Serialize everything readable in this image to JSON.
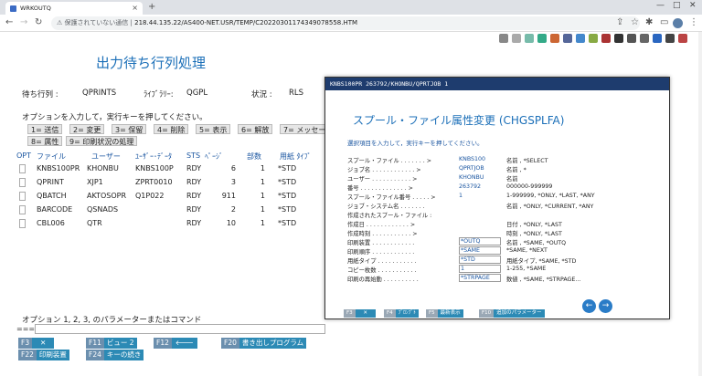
{
  "browser": {
    "tab_title": "WRKOUTQ",
    "tab_close": "×",
    "new_tab": "+",
    "security_warning": "保護されていない通信",
    "url": "218.44.135.22/AS400-NET.USR/TEMP/C20220301174349078558.HTM"
  },
  "page": {
    "title": "出力待ち行列処理",
    "outq_label": "待ち行列 :",
    "outq_value": "QPRINTS",
    "library_label": "ﾗｲﾌﾞﾗﾘｰ:",
    "library_value": "QGPL",
    "status_label": "状況 :",
    "status_value": "RLS",
    "instruction": "オプションを入力して，実行キーを押してください。",
    "options": [
      "1= 送信",
      "2= 変更",
      "3= 保留",
      "4= 削除",
      "5= 表示",
      "6= 解放",
      "7= メッセー",
      "8= 属性",
      "9= 印刷状況の処理"
    ],
    "columns": [
      "OPT",
      "ファイル",
      "ユーザー",
      "ﾕｰｻﾞｰ･ﾃﾞｰﾀ",
      "STS",
      "ﾍﾟｰｼﾞ",
      "部数",
      "用紙 ﾀｲﾌﾟ"
    ],
    "rows": [
      {
        "file": "KNBS100PR",
        "user": "KHONBU",
        "udata": "KNBS100P",
        "sts": "RDY",
        "pages": "6",
        "copies": "1",
        "form": "*STD"
      },
      {
        "file": "QPRINT",
        "user": "XJP1",
        "udata": "ZPRT0010",
        "sts": "RDY",
        "pages": "3",
        "copies": "1",
        "form": "*STD"
      },
      {
        "file": "QBATCH",
        "user": "AKTOSOPR",
        "udata": "Q1P022",
        "sts": "RDY",
        "pages": "911",
        "copies": "1",
        "form": "*STD"
      },
      {
        "file": "BARCODE",
        "user": "QSNADS",
        "udata": "",
        "sts": "RDY",
        "pages": "2",
        "copies": "1",
        "form": "*STD"
      },
      {
        "file": "CBL006",
        "user": "QTR",
        "udata": "",
        "sts": "RDY",
        "pages": "10",
        "copies": "1",
        "form": "*STD"
      }
    ],
    "param_label": "オプション 1, 2, 3, のパラメーターまたはコマンド",
    "prompt": "===>",
    "fkeys": [
      {
        "key": "F3",
        "label": "✕"
      },
      {
        "key": "F11",
        "label": "ビュー 2"
      },
      {
        "key": "F12",
        "label": "🡐"
      },
      {
        "key": "F20",
        "label": "書き出しプログラム"
      },
      {
        "key": "F22",
        "label": "印刷装置"
      },
      {
        "key": "F24",
        "label": "キーの続き"
      }
    ]
  },
  "modal": {
    "titlebar": "KNBS100PR 263792/KHONBU/QPRTJOB 1",
    "title": "スプール・ファイル属性変更 (CHGSPLFA)",
    "instruction": "選択項目を入力して，実行キーを押してください。",
    "params": [
      {
        "label": "スプール・ファイル . . . . . . . >",
        "value": "KNBS100",
        "desc": "名前 , *SELECT"
      },
      {
        "label": "ジョブ名 . . . . . . . . . . . . >",
        "value": "QPRTJOB",
        "desc": "名前 , *"
      },
      {
        "label": "    ユーザー . . . . . . . . . . . >",
        "value": "KHONBU",
        "desc": "名前"
      },
      {
        "label": "    番号 . . . . . . . . . . . . . >",
        "value": "263792",
        "desc": "000000-999999"
      },
      {
        "label": "スプール・ファイル番号 . . . . . >",
        "value": "1",
        "desc": "1-999999, *ONLY, *LAST, *ANY"
      },
      {
        "label": "ジョブ・システム名 . . . . . . .",
        "value": "",
        "desc": "名前 , *ONLY, *CURRENT, *ANY"
      },
      {
        "label": "作成されたスプール・ファイル :",
        "value": "",
        "desc": ""
      },
      {
        "label": "    作成日 . . . . . . . . . . . . >",
        "value": "",
        "desc": "日付 , *ONLY, *LAST"
      },
      {
        "label": "    作成時刻 . . . . . . . . . . . >",
        "value": "",
        "desc": "時刻 , *ONLY, *LAST"
      },
      {
        "label": "印刷装置 . . . . . . . . . . . .",
        "input": "*OUTQ",
        "desc": "名前 , *SAME, *OUTQ"
      },
      {
        "label": "印刷順序 . . . . . . . . . . . .",
        "input": "*SAME",
        "desc": "*SAME, *NEXT"
      },
      {
        "label": "用紙タイプ . . . . . . . . . . .",
        "input": "*STD",
        "desc": "用紙タイプ, *SAME, *STD"
      },
      {
        "label": "コピー枚数 . . . . . . . . . . .",
        "input": "1",
        "desc": "1-255, *SAME"
      },
      {
        "label": "印刷の再始動 . . . . . . . . . .",
        "input": "*STRPAGE",
        "desc": "数値 , *SAME, *STRPAGE..."
      }
    ],
    "fkeys": [
      {
        "key": "F3",
        "label": "✕"
      },
      {
        "key": "F4",
        "label": "ﾌﾟﾛﾝﾌﾟﾄ"
      },
      {
        "key": "F5",
        "label": "最新表示"
      },
      {
        "key": "F10",
        "label": "追加のパラメーター"
      }
    ],
    "prev": "←",
    "next": "→"
  }
}
